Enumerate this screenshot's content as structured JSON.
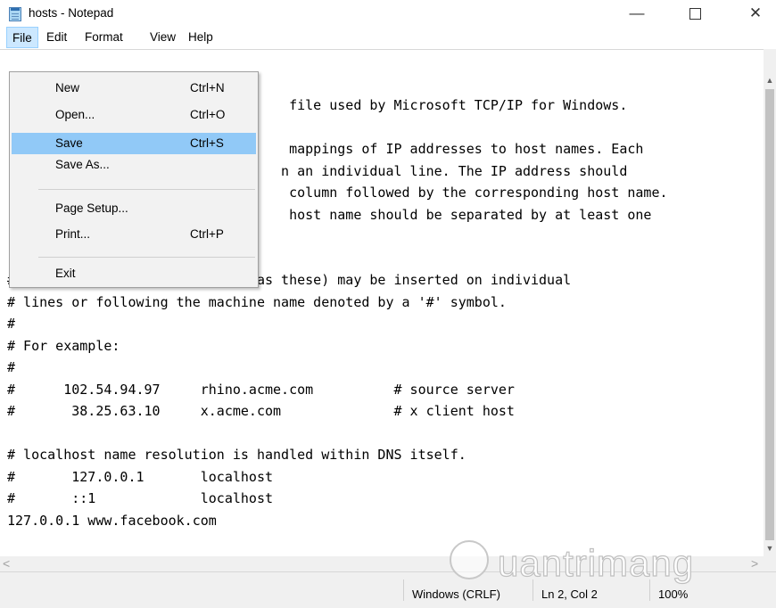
{
  "window": {
    "title": "hosts - Notepad",
    "min_glyph": "—",
    "close_glyph": "✕"
  },
  "menubar": {
    "file": "File",
    "edit": "Edit",
    "format": "Format",
    "view": "View",
    "help": "Help"
  },
  "file_menu": {
    "items": [
      {
        "label": "New",
        "shortcut": "Ctrl+N"
      },
      {
        "label": "Open...",
        "shortcut": "Ctrl+O"
      },
      {
        "label": "Save",
        "shortcut": "Ctrl+S"
      },
      {
        "label": "Save As...",
        "shortcut": ""
      },
      {
        "label": "Page Setup...",
        "shortcut": ""
      },
      {
        "label": "Print...",
        "shortcut": "Ctrl+P"
      },
      {
        "label": "Exit",
        "shortcut": ""
      }
    ],
    "highlighted": "Save"
  },
  "editor": {
    "text": "                                   file used by Microsoft TCP/IP for Windows.\n\n                                   mappings of IP addresses to host names. Each\n                                  n an individual line. The IP address should\n                                   column followed by the corresponding host name.\n                                   host name should be separated by at least one\n\n\n# Additionally, comments (such as these) may be inserted on individual\n# lines or following the machine name denoted by a '#' symbol.\n#\n# For example:\n#\n#      102.54.94.97     rhino.acme.com          # source server\n#       38.25.63.10     x.acme.com              # x client host\n\n# localhost name resolution is handled within DNS itself.\n#       127.0.0.1       localhost\n#       ::1             localhost\n127.0.0.1 www.facebook.com"
  },
  "statusbar": {
    "encoding": "Windows (CRLF)",
    "position": "Ln 2, Col 2",
    "zoom": "100%"
  },
  "watermark": {
    "text": "uantrimang"
  },
  "icons": {
    "app": "notepad-icon",
    "scroll_up": "▲",
    "scroll_down": "▼",
    "scroll_left": "<",
    "scroll_right": ">"
  },
  "colors": {
    "menu_highlight": "#91c9f7",
    "menubar_active": "#cce8ff"
  }
}
